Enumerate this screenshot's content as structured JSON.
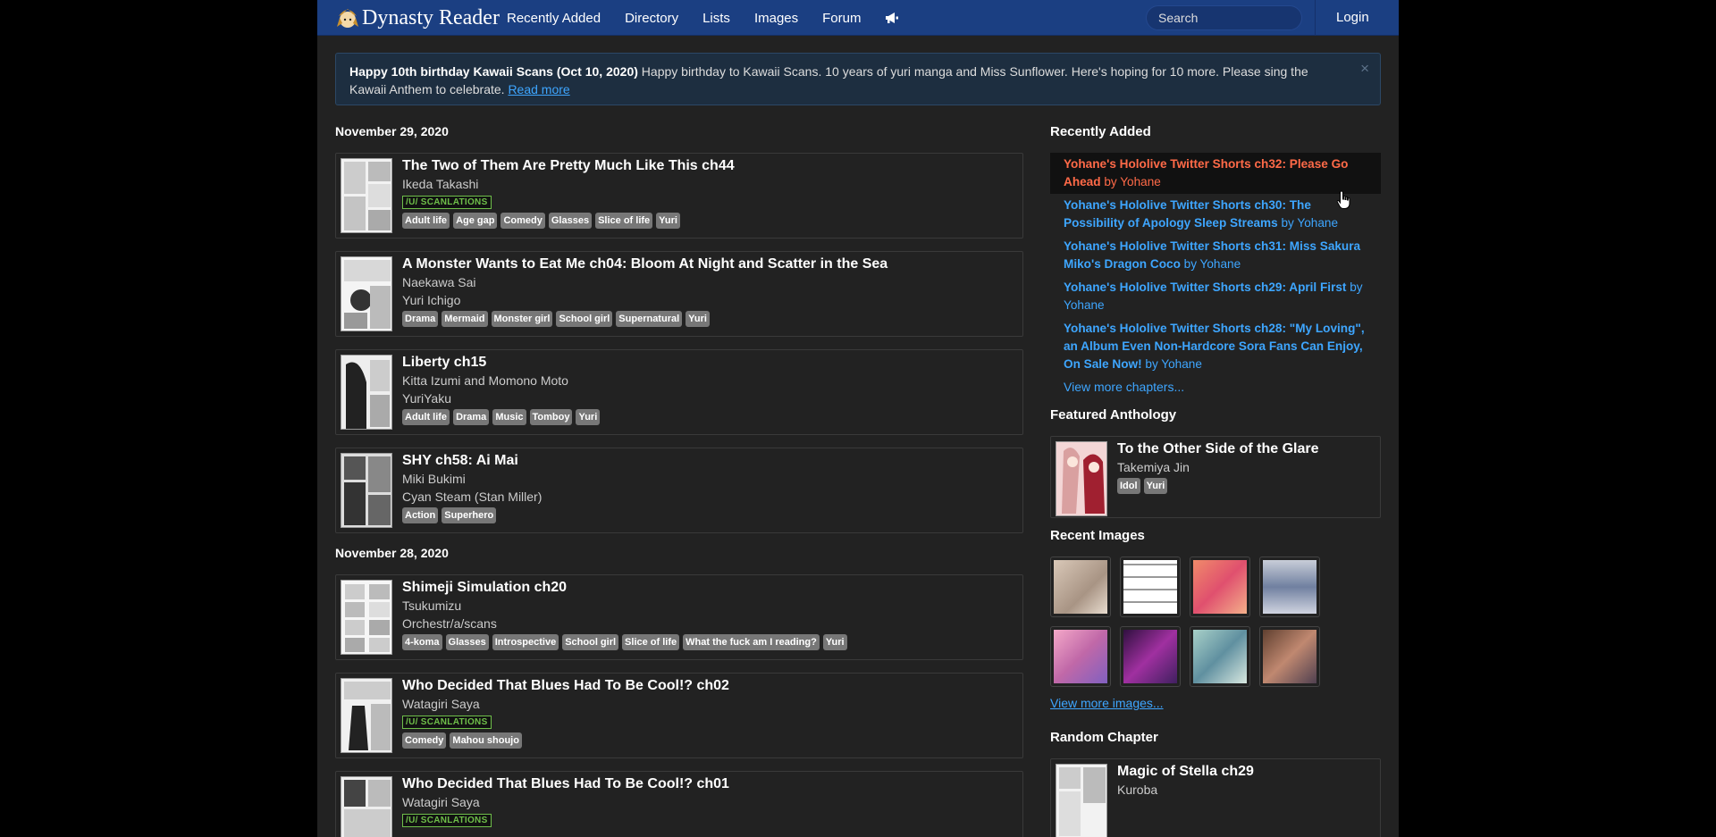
{
  "nav": {
    "brand": "Dynasty Reader",
    "links": [
      "Recently Added",
      "Directory",
      "Lists",
      "Images",
      "Forum"
    ],
    "search_placeholder": "Search",
    "login": "Login"
  },
  "alert": {
    "title": "Happy 10th birthday Kawaii Scans (Oct 10, 2020)",
    "text": " Happy birthday to Kawaii Scans. 10 years of yuri manga and Miss Sunflower. Here's hoping for 10 more. Please sing the Kawaii Anthem to celebrate. ",
    "link": "Read more",
    "close": "×"
  },
  "groups": [
    {
      "date": "November 29, 2020",
      "items": [
        {
          "title": "The Two of Them Are Pretty Much Like This ch44",
          "lines": [
            "Ikeda Takashi"
          ],
          "logo": "/U/ SCANLATIONS",
          "tags": [
            "Adult life",
            "Age gap",
            "Comedy",
            "Glasses",
            "Slice of life",
            "Yuri"
          ]
        },
        {
          "title": "A Monster Wants to Eat Me ch04: Bloom At Night and Scatter in the Sea",
          "lines": [
            "Naekawa Sai",
            "Yuri Ichigo"
          ],
          "logo": "",
          "tags": [
            "Drama",
            "Mermaid",
            "Monster girl",
            "School girl",
            "Supernatural",
            "Yuri"
          ]
        },
        {
          "title": "Liberty ch15",
          "lines": [
            "Kitta Izumi and Momono Moto",
            "YuriYaku"
          ],
          "logo": "",
          "tags": [
            "Adult life",
            "Drama",
            "Music",
            "Tomboy",
            "Yuri"
          ]
        },
        {
          "title": "SHY ch58: Ai Mai",
          "lines": [
            "Miki Bukimi",
            "Cyan Steam (Stan Miller)"
          ],
          "logo": "",
          "tags": [
            "Action",
            "Superhero"
          ]
        }
      ]
    },
    {
      "date": "November 28, 2020",
      "items": [
        {
          "title": "Shimeji Simulation ch20",
          "lines": [
            "Tsukumizu",
            "Orchestr/a/scans"
          ],
          "logo": "",
          "tags": [
            "4-koma",
            "Glasses",
            "Introspective",
            "School girl",
            "Slice of life",
            "What the fuck am I reading?",
            "Yuri"
          ]
        },
        {
          "title": "Who Decided That Blues Had To Be Cool!? ch02",
          "lines": [
            "Watagiri Saya"
          ],
          "logo": "/U/ SCANLATIONS",
          "tags": [
            "Comedy",
            "Mahou shoujo"
          ]
        },
        {
          "title": "Who Decided That Blues Had To Be Cool!? ch01",
          "lines": [
            "Watagiri Saya"
          ],
          "logo": "/U/ SCANLATIONS",
          "tags": []
        }
      ]
    }
  ],
  "sidebar": {
    "recent_title": "Recently Added",
    "recent": [
      {
        "title": "Yohane's Hololive Twitter Shorts ch32: Please Go Ahead",
        "by": " by Yohane"
      },
      {
        "title": "Yohane's Hololive Twitter Shorts ch30: The Possibility of Apology Sleep Streams",
        "by": " by Yohane"
      },
      {
        "title": "Yohane's Hololive Twitter Shorts ch31: Miss Sakura Miko's Dragon Coco",
        "by": " by Yohane"
      },
      {
        "title": "Yohane's Hololive Twitter Shorts ch29: April First",
        "by": " by Yohane"
      },
      {
        "title": "Yohane's Hololive Twitter Shorts ch28: \"My Loving\", an Album Even Non-Hardcore Sora Fans Can Enjoy, On Sale Now!",
        "by": " by Yohane"
      }
    ],
    "view_more_chapters": "View more chapters...",
    "featured_title": "Featured Anthology",
    "featured": {
      "title": "To the Other Side of the Glare",
      "author": "Takemiya Jin",
      "tags": [
        "Idol",
        "Yuri"
      ]
    },
    "images_title": "Recent Images",
    "view_more_images": "View more images...",
    "random_title": "Random Chapter",
    "random": {
      "title": "Magic of Stella ch29",
      "author": "Kuroba"
    }
  },
  "colors": {
    "navbar": "#1b3f82",
    "link": "#3ea6ff",
    "hover": "#ff6a48",
    "tag": "#777777"
  }
}
